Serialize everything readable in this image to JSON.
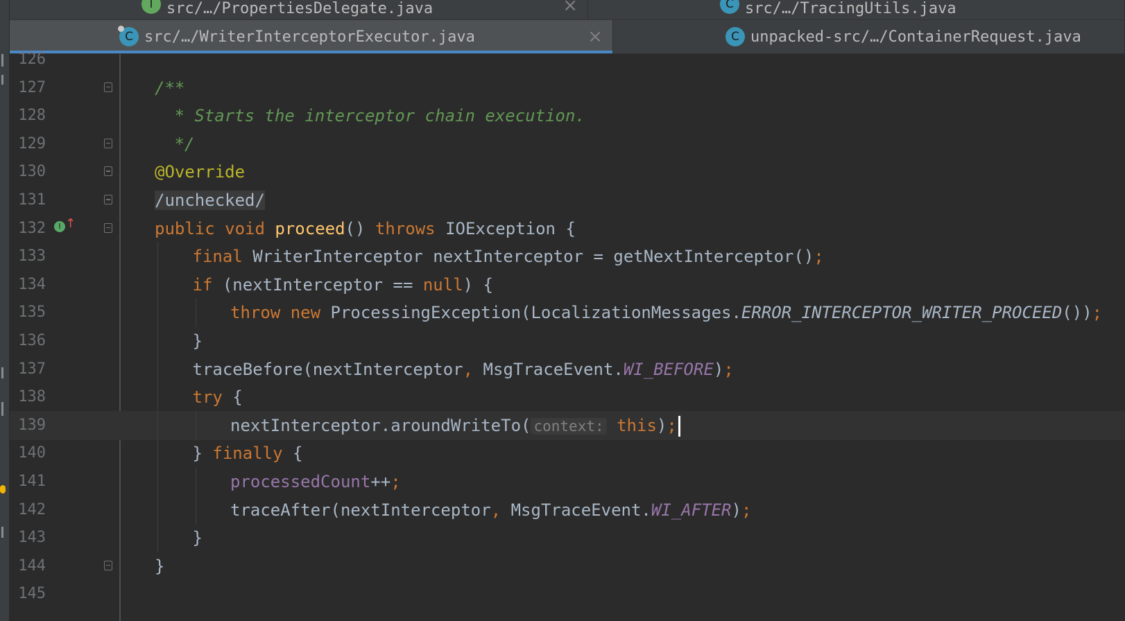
{
  "tabs": {
    "row1": [
      {
        "label": "src/…/PropertiesDelegate.java",
        "icon": "I",
        "icon_kind": "interface"
      },
      {
        "label": "src/…/TracingUtils.java",
        "icon": "C",
        "icon_kind": "class"
      }
    ],
    "row2": [
      {
        "label": "src/…/WriterInterceptorExecutor.java",
        "icon": "C",
        "icon_kind": "class",
        "active": true
      },
      {
        "label": "unpacked-src/…/ContainerRequest.java",
        "icon": "C",
        "icon_kind": "class"
      }
    ],
    "close_glyph": "×"
  },
  "editor": {
    "lines": [
      {
        "n": "126",
        "tokens": []
      },
      {
        "n": "127",
        "tokens": [
          {
            "t": "/**",
            "c": "com"
          }
        ]
      },
      {
        "n": "128",
        "tokens": [
          {
            "t": " * Starts the interceptor chain execution.",
            "c": "com"
          }
        ]
      },
      {
        "n": "129",
        "tokens": [
          {
            "t": " */",
            "c": "com"
          }
        ]
      },
      {
        "n": "130",
        "tokens": [
          {
            "t": "@Override",
            "c": "ann"
          }
        ]
      },
      {
        "n": "131",
        "tokens": [
          {
            "t": "/unchecked/",
            "c": "fold"
          }
        ]
      },
      {
        "n": "132",
        "tokens": [
          {
            "t": "public void ",
            "c": "kw"
          },
          {
            "t": "proceed",
            "c": "meth"
          },
          {
            "t": "() ",
            "c": "plain"
          },
          {
            "t": "throws ",
            "c": "kw"
          },
          {
            "t": "IOException {",
            "c": "plain"
          }
        ]
      },
      {
        "n": "133",
        "tokens": [
          {
            "t": "final ",
            "c": "kw"
          },
          {
            "t": "WriterInterceptor nextInterceptor = getNextInterceptor()",
            "c": "plain"
          },
          {
            "t": ";",
            "c": "kw"
          }
        ]
      },
      {
        "n": "134",
        "tokens": [
          {
            "t": "if ",
            "c": "kw"
          },
          {
            "t": "(nextInterceptor == ",
            "c": "plain"
          },
          {
            "t": "null",
            "c": "kw"
          },
          {
            "t": ") {",
            "c": "plain"
          }
        ]
      },
      {
        "n": "135",
        "tokens": [
          {
            "t": "throw new ",
            "c": "kw"
          },
          {
            "t": "ProcessingException(LocalizationMessages.",
            "c": "plain"
          },
          {
            "t": "ERROR_INTERCEPTOR_WRITER_PROCEED",
            "c": "plain-i"
          },
          {
            "t": "())",
            "c": "plain"
          },
          {
            "t": ";",
            "c": "kw"
          }
        ]
      },
      {
        "n": "136",
        "tokens": [
          {
            "t": "}",
            "c": "plain"
          }
        ]
      },
      {
        "n": "137",
        "tokens": [
          {
            "t": "traceBefore(nextInterceptor",
            "c": "plain"
          },
          {
            "t": ", ",
            "c": "kw"
          },
          {
            "t": "MsgTraceEvent.",
            "c": "plain"
          },
          {
            "t": "WI_BEFORE",
            "c": "stat"
          },
          {
            "t": ")",
            "c": "plain"
          },
          {
            "t": ";",
            "c": "kw"
          }
        ]
      },
      {
        "n": "138",
        "tokens": [
          {
            "t": "try ",
            "c": "kw"
          },
          {
            "t": "{",
            "c": "plain"
          }
        ]
      },
      {
        "n": "139",
        "tokens": [
          {
            "t": "nextInterceptor.aroundWriteTo(",
            "c": "plain"
          },
          {
            "t": "context:",
            "c": "hint"
          },
          {
            "t": " this",
            "c": "kw"
          },
          {
            "t": ")",
            "c": "plain"
          },
          {
            "t": ";",
            "c": "kw"
          }
        ]
      },
      {
        "n": "140",
        "tokens": [
          {
            "t": "} ",
            "c": "plain"
          },
          {
            "t": "finally ",
            "c": "kw"
          },
          {
            "t": "{",
            "c": "plain"
          }
        ]
      },
      {
        "n": "141",
        "tokens": [
          {
            "t": "processedCount",
            "c": "field"
          },
          {
            "t": "++",
            "c": "plain"
          },
          {
            "t": ";",
            "c": "kw"
          }
        ]
      },
      {
        "n": "142",
        "tokens": [
          {
            "t": "traceAfter(nextInterceptor",
            "c": "plain"
          },
          {
            "t": ", ",
            "c": "kw"
          },
          {
            "t": "MsgTraceEvent.",
            "c": "plain"
          },
          {
            "t": "WI_AFTER",
            "c": "stat"
          },
          {
            "t": ")",
            "c": "plain"
          },
          {
            "t": ";",
            "c": "kw"
          }
        ]
      },
      {
        "n": "143",
        "tokens": [
          {
            "t": "}",
            "c": "plain"
          }
        ]
      },
      {
        "n": "144",
        "tokens": [
          {
            "t": "}",
            "c": "plain"
          }
        ]
      },
      {
        "n": "145",
        "tokens": []
      }
    ],
    "current_line": "139",
    "gutter_icons": {
      "line": "132",
      "names": [
        "implementing-method-icon",
        "override-up-arrow-icon"
      ]
    },
    "colors": {
      "keyword": "#cc7832",
      "comment": "#629755",
      "annotation": "#bbb529",
      "method": "#ffc66d",
      "static_field": "#9876aa",
      "text": "#a9b7c6",
      "accent": "#4a88c7"
    }
  }
}
